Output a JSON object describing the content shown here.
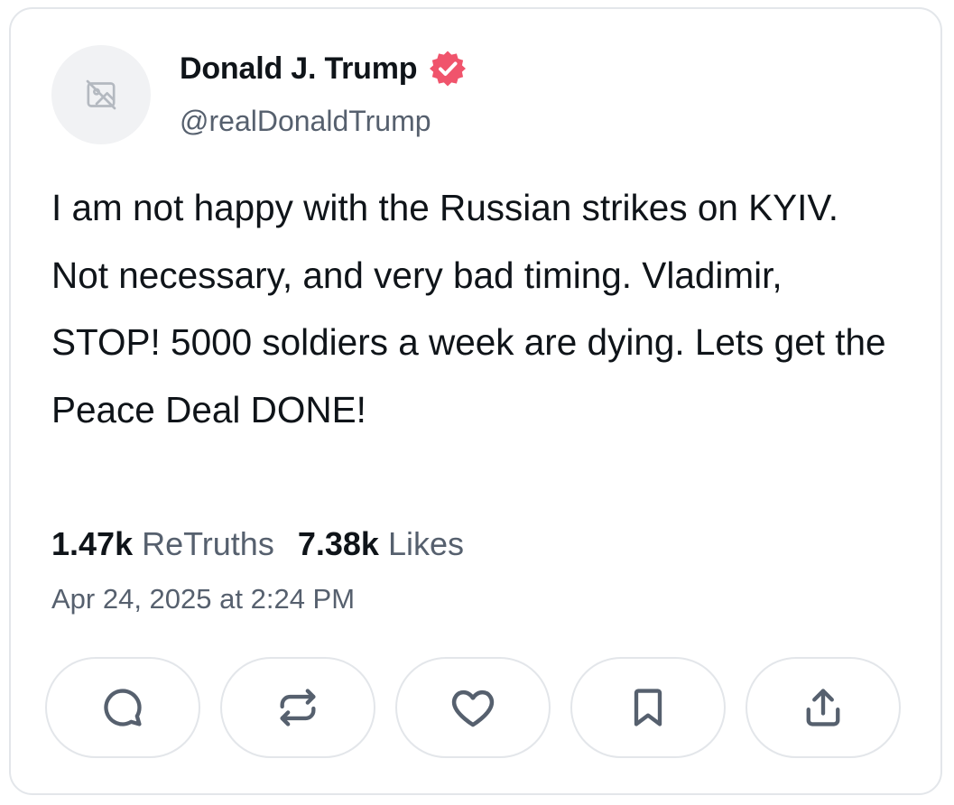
{
  "author": {
    "display_name": "Donald J. Trump",
    "handle": "@realDonaldTrump",
    "verified_badge_color": "#f0546c",
    "avatar_icon": "broken-image-icon"
  },
  "post": {
    "text": "I am not happy with the Russian strikes on KYIV. Not necessary, and very bad timing. Vladimir, STOP! 5000 soldiers a week are dying. Lets get the Peace Deal DONE!",
    "retruths_count": "1.47k",
    "retruths_label": "ReTruths",
    "likes_count": "7.38k",
    "likes_label": "Likes",
    "timestamp": "Apr 24, 2025 at 2:24 PM"
  },
  "actions": [
    {
      "name": "reply",
      "icon": "chat-bubble-icon"
    },
    {
      "name": "retruth",
      "icon": "repost-icon"
    },
    {
      "name": "like",
      "icon": "heart-icon"
    },
    {
      "name": "bookmark",
      "icon": "bookmark-icon"
    },
    {
      "name": "share",
      "icon": "share-icon"
    }
  ],
  "colors": {
    "text_primary": "#0f1419",
    "text_secondary": "#56606e",
    "border": "#e3e6ea",
    "icon": "#56606e"
  }
}
